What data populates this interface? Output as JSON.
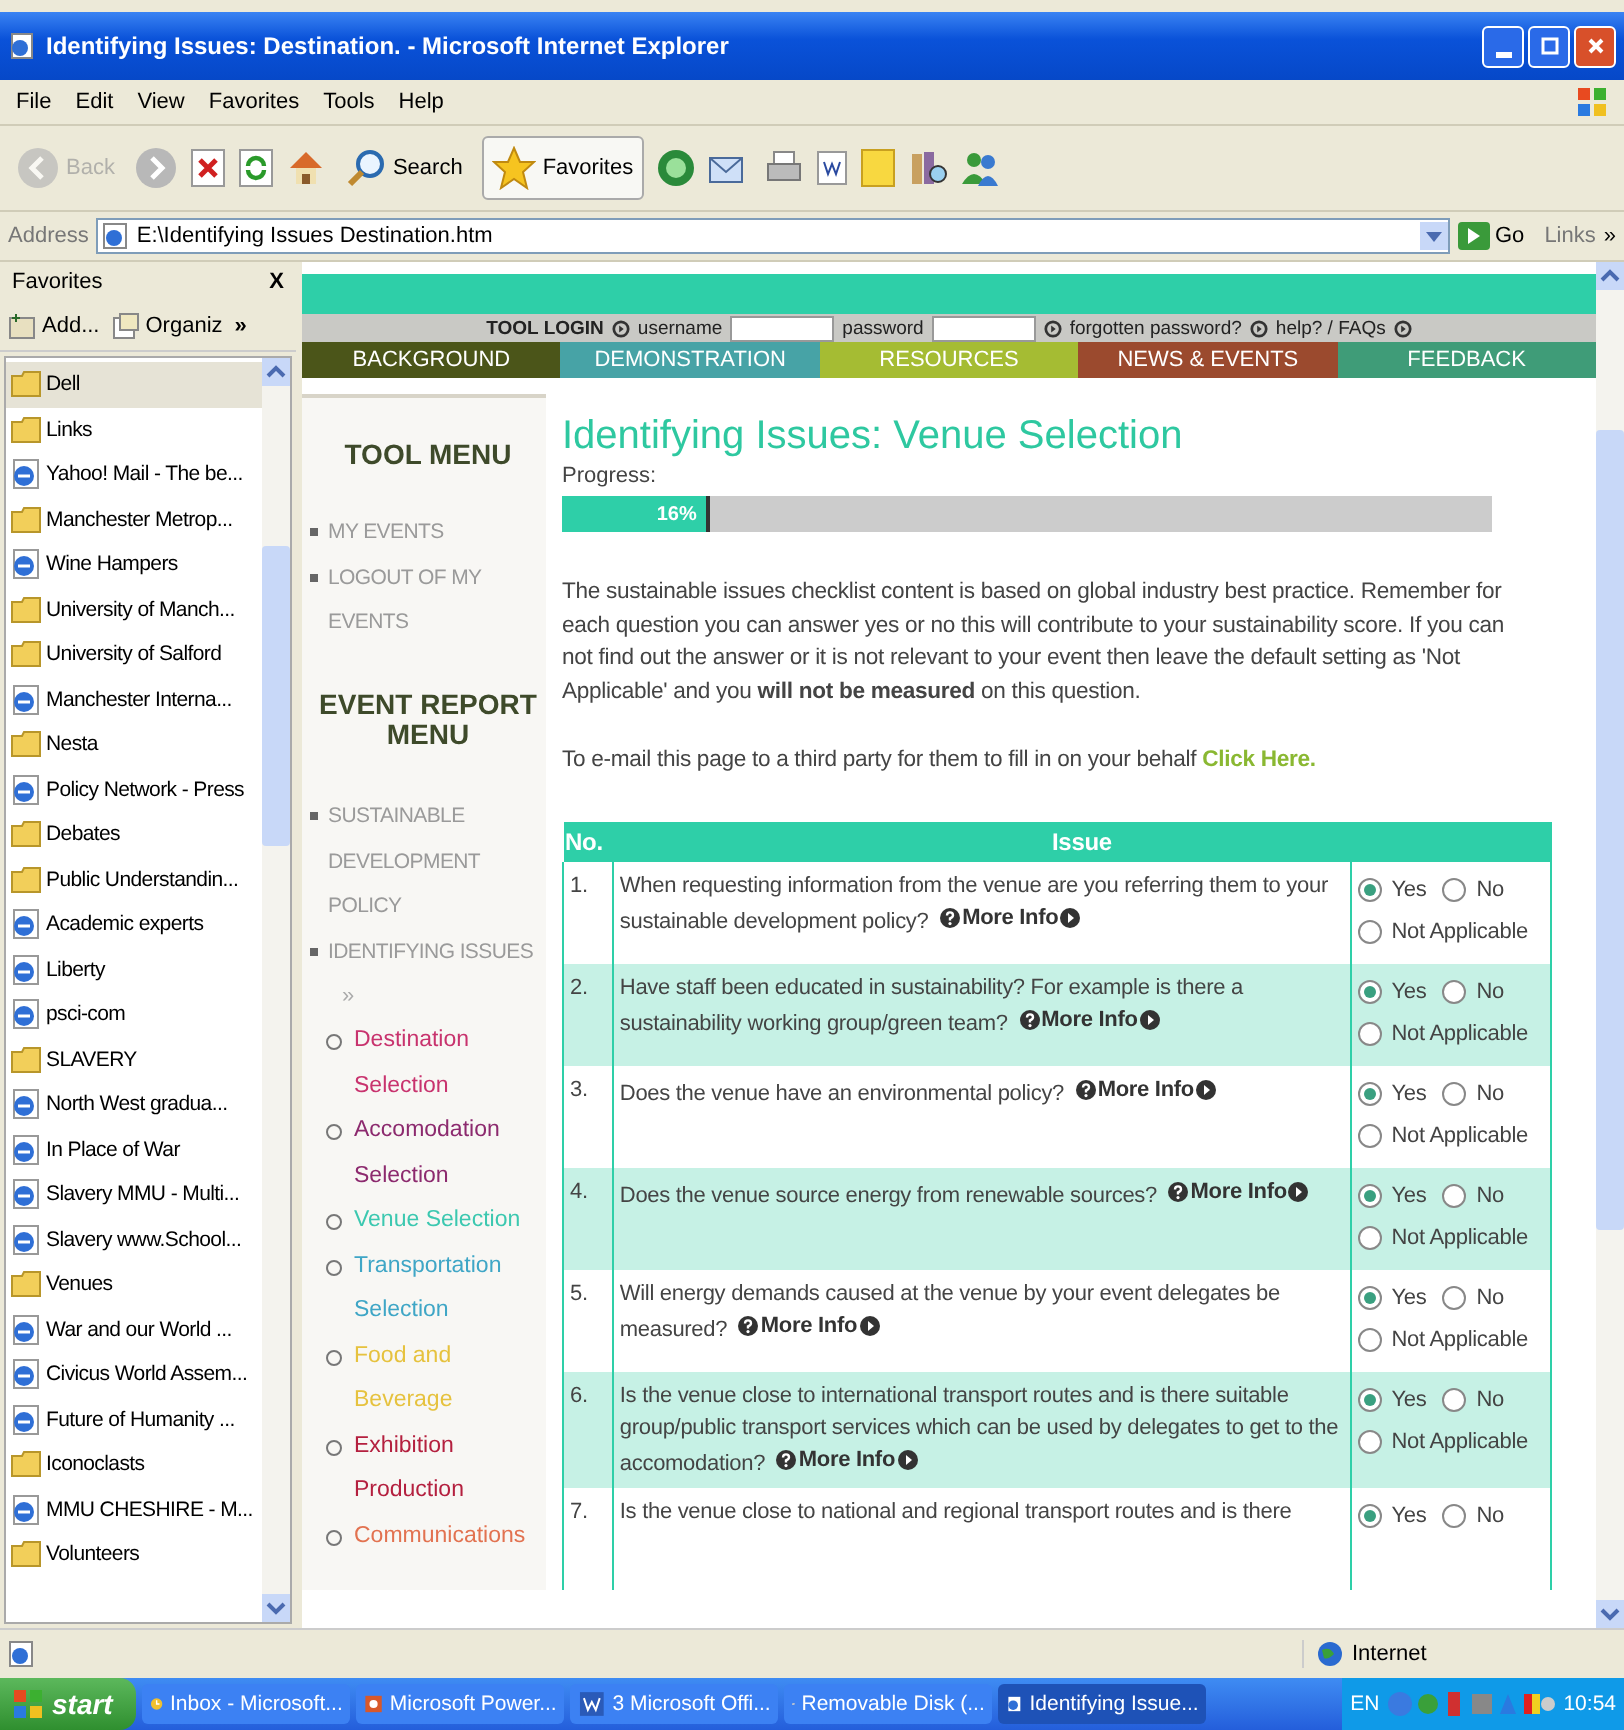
{
  "window": {
    "title": "Identifying Issues: Destination. - Microsoft Internet Explorer"
  },
  "menu": [
    "File",
    "Edit",
    "View",
    "Favorites",
    "Tools",
    "Help"
  ],
  "toolbar": [
    {
      "kind": "back",
      "label": "Back",
      "disabled": true
    },
    {
      "kind": "search",
      "label": "Search"
    },
    {
      "kind": "favorites",
      "label": "Favorites"
    }
  ],
  "address": {
    "label": "Address",
    "value": "E:\\Identifying Issues Destination.htm",
    "go": "Go",
    "links": "Links",
    "more": "»"
  },
  "favorites": {
    "title": "Favorites",
    "close": "X",
    "add": "Add...",
    "organize": "Organiz",
    "more": "»",
    "items": [
      {
        "kind": "folder",
        "label": "Dell",
        "selected": true
      },
      {
        "kind": "folder",
        "label": "Links",
        "selected": false
      },
      {
        "kind": "page",
        "label": "Yahoo! Mail - The be...",
        "selected": false
      },
      {
        "kind": "folder",
        "label": "Manchester Metrop...",
        "selected": false
      },
      {
        "kind": "page",
        "label": "Wine Hampers",
        "selected": false
      },
      {
        "kind": "folder",
        "label": "University of Manch...",
        "selected": false
      },
      {
        "kind": "folder",
        "label": "University of Salford",
        "selected": false
      },
      {
        "kind": "page",
        "label": "Manchester Interna...",
        "selected": false
      },
      {
        "kind": "folder",
        "label": "Nesta",
        "selected": false
      },
      {
        "kind": "page",
        "label": "Policy Network - Press",
        "selected": false
      },
      {
        "kind": "folder",
        "label": "Debates",
        "selected": false
      },
      {
        "kind": "folder",
        "label": "Public Understandin...",
        "selected": false
      },
      {
        "kind": "page",
        "label": "Academic experts",
        "selected": false
      },
      {
        "kind": "page",
        "label": "Liberty",
        "selected": false
      },
      {
        "kind": "page",
        "label": "psci-com",
        "selected": false
      },
      {
        "kind": "folder",
        "label": "SLAVERY",
        "selected": false
      },
      {
        "kind": "page",
        "label": "North West gradua...",
        "selected": false
      },
      {
        "kind": "page",
        "label": "In Place of War",
        "selected": false
      },
      {
        "kind": "page",
        "label": "Slavery MMU - Multi...",
        "selected": false
      },
      {
        "kind": "page",
        "label": "Slavery www.School...",
        "selected": false
      },
      {
        "kind": "folder",
        "label": "Venues",
        "selected": false
      },
      {
        "kind": "page",
        "label": "War and our World ...",
        "selected": false
      },
      {
        "kind": "page",
        "label": "Civicus World Assem...",
        "selected": false
      },
      {
        "kind": "page",
        "label": "Future of Humanity ...",
        "selected": false
      },
      {
        "kind": "folder",
        "label": "Iconoclasts",
        "selected": false
      },
      {
        "kind": "page",
        "label": "MMU CHESHIRE - M...",
        "selected": false
      },
      {
        "kind": "folder",
        "label": "Volunteers",
        "selected": false
      }
    ]
  },
  "login": {
    "title": "TOOL LOGIN",
    "username": "username",
    "password": "password",
    "forgotten": "forgotten password?",
    "help": "help? / FAQs"
  },
  "nav": [
    {
      "label": "BACKGROUND",
      "color": "#4b5519"
    },
    {
      "label": "DEMONSTRATION",
      "color": "#47a3a6"
    },
    {
      "label": "RESOURCES",
      "color": "#a5bc33"
    },
    {
      "label": "NEWS & EVENTS",
      "color": "#9b4a2e"
    },
    {
      "label": "FEEDBACK",
      "color": "#3f9c78"
    }
  ],
  "tool_menu": {
    "title": "TOOL MENU",
    "items": [
      "MY EVENTS",
      "LOGOUT OF MY EVENTS"
    ]
  },
  "event_report_menu": {
    "title": "EVENT REPORT MENU",
    "items": [
      {
        "label": "SUSTAINABLE DEVELOPMENT POLICY"
      },
      {
        "label": "IDENTIFYING ISSUES",
        "suffix": "»",
        "children": [
          {
            "label": "Destination Selection",
            "color": "#c8336e"
          },
          {
            "label": "Accomodation Selection",
            "color": "#8c2a6e"
          },
          {
            "label": "Venue Selection",
            "color": "#3cc8b0"
          },
          {
            "label": "Transportation Selection",
            "color": "#3fa6c6"
          },
          {
            "label": "Food and Beverage",
            "color": "#e6c23e"
          },
          {
            "label": "Exhibition Production",
            "color": "#b4203f"
          },
          {
            "label": "Communications",
            "color": "#e27250"
          }
        ]
      }
    ]
  },
  "heading": "Identifying Issues:  Venue Selection",
  "progress": {
    "label": "Progress:",
    "level": 0.16,
    "text": "16%"
  },
  "intro": "The sustainable issues checklist content is based on global industry best practice. Remember for each question you can answer yes or no this will contribute to your sustainability score. If you can not find out the answer or it is not relevant to your event then leave the default setting as 'Not Applicable' and you **will not be measured** on this question.",
  "email": {
    "text": "To e-mail this page to a third party for them to fill in on your behalf",
    "link": "Click Here."
  },
  "table": {
    "columns": [
      "No.",
      "Issue"
    ],
    "rows": [
      {
        "no": "1.",
        "question": "When requesting information from the venue are you referring them to your sustainable development policy?",
        "more_info": "More Info",
        "options": [
          {
            "label": "Yes",
            "selected": true
          },
          {
            "label": "No",
            "selected": false
          },
          {
            "label": "Not Applicable",
            "selected": false
          }
        ]
      },
      {
        "no": "2.",
        "question": "Have staff been educated in sustainability? For example is there a sustainability working group/green team?",
        "more_info": "More Info",
        "options": [
          {
            "label": "Yes",
            "selected": true
          },
          {
            "label": "No",
            "selected": false
          },
          {
            "label": "Not Applicable",
            "selected": false
          }
        ]
      },
      {
        "no": "3.",
        "question": "Does the venue have an environmental policy?",
        "more_info": "More Info",
        "options": [
          {
            "label": "Yes",
            "selected": true
          },
          {
            "label": "No",
            "selected": false
          },
          {
            "label": "Not Applicable",
            "selected": false
          }
        ]
      },
      {
        "no": "4.",
        "question": "Does the venue source energy from renewable sources?",
        "more_info": "More Info",
        "options": [
          {
            "label": "Yes",
            "selected": true
          },
          {
            "label": "No",
            "selected": false
          },
          {
            "label": "Not Applicable",
            "selected": false
          }
        ]
      },
      {
        "no": "5.",
        "question": "Will energy demands caused at the venue by your event delegates be measured?",
        "more_info": "More Info",
        "options": [
          {
            "label": "Yes",
            "selected": true
          },
          {
            "label": "No",
            "selected": false
          },
          {
            "label": "Not Applicable",
            "selected": false
          }
        ]
      },
      {
        "no": "6.",
        "question": "Is the venue close to international transport routes and is there suitable group/public transport services which can be used by delegates to get to the accomodation?",
        "more_info": "More Info",
        "options": [
          {
            "label": "Yes",
            "selected": true
          },
          {
            "label": "No",
            "selected": false
          },
          {
            "label": "Not Applicable",
            "selected": false
          }
        ]
      },
      {
        "no": "7.",
        "question": "Is the venue close to national and regional transport routes and is there",
        "options": [
          {
            "label": "Yes",
            "selected": true
          },
          {
            "label": "No",
            "selected": false
          }
        ]
      }
    ]
  },
  "status_bar": {
    "zone": "Internet"
  },
  "taskbar": {
    "start": "start",
    "tasks": [
      {
        "kind": "mail",
        "label": "Inbox - Microsoft...",
        "selected": false
      },
      {
        "kind": "slides",
        "label": "Microsoft Power...",
        "selected": false
      },
      {
        "kind": "word",
        "label": "3 Microsoft Offi...",
        "selected": false
      },
      {
        "kind": "disk",
        "label": "Removable Disk (...",
        "selected": false
      },
      {
        "kind": "ie",
        "label": "Identifying Issue...",
        "selected": true
      }
    ],
    "language": "EN",
    "clock": "10:54"
  }
}
